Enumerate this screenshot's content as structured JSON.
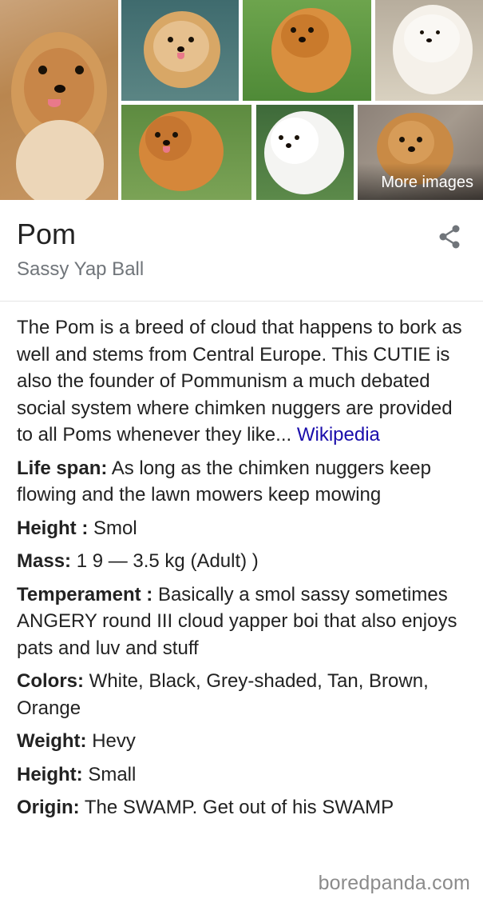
{
  "gallery": {
    "more_label": "More images",
    "thumbnails": [
      {
        "name": "pomeranian-photo-1"
      },
      {
        "name": "pomeranian-photo-2"
      },
      {
        "name": "pomeranian-photo-3"
      },
      {
        "name": "pomeranian-photo-4"
      },
      {
        "name": "pomeranian-photo-5"
      },
      {
        "name": "pomeranian-photo-6"
      },
      {
        "name": "pomeranian-photo-7"
      }
    ]
  },
  "panel": {
    "title": "Pom",
    "subtitle": "Sassy Yap Ball",
    "share_icon": "share-icon"
  },
  "description": {
    "text": "The Pom is a breed of cloud that happens to bork as well and stems from Central Europe. This CUTIE is also the founder of Pommunism a much debated social system where chimken nuggers are provided to all Poms whenever they like... ",
    "source_link": "Wikipedia"
  },
  "facts": [
    {
      "label": "Life span:",
      "value": "As long as the chimken nuggers keep flowing and the lawn mowers keep mowing"
    },
    {
      "label": "Height :",
      "value": "Smol"
    },
    {
      "label": "Mass:",
      "value": "1 9 — 3.5 kg (Adult) )"
    },
    {
      "label": "Temperament :",
      "value": "Basically a smol sassy sometimes ANGERY round III cloud yapper boi that also enjoys pats and luv and stuff"
    },
    {
      "label": "Colors:",
      "value": "White, Black, Grey-shaded, Tan, Brown, Orange"
    },
    {
      "label": "Weight:",
      "value": "Hevy"
    },
    {
      "label": "Height:",
      "value": "Small"
    },
    {
      "label": "Origin:",
      "value": "The SWAMP. Get out of his SWAMP"
    }
  ],
  "watermark": "boredpanda.com",
  "colors": {
    "link": "#1a0dab",
    "subtitle": "#70757a",
    "text": "#222222"
  }
}
